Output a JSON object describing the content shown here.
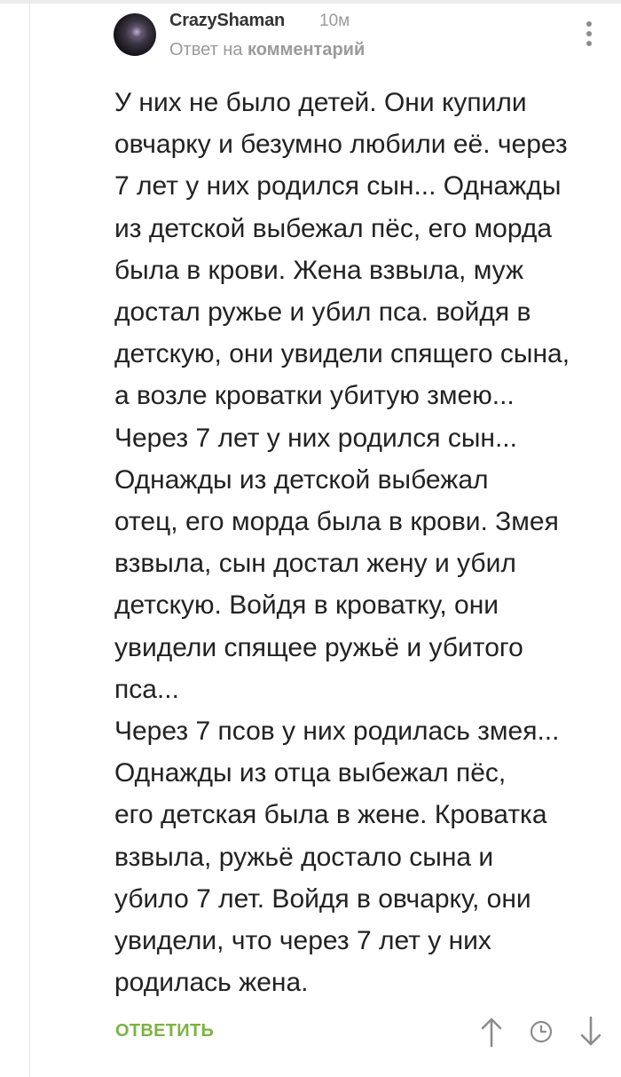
{
  "comment": {
    "author": "CrazyShaman",
    "time": "10м",
    "reply_to_prefix": "Ответ на",
    "reply_to_link": "комментарий",
    "body_lines": [
      "У них не было детей. Они купили",
      "овчарку и безумно любили её. через",
      "7 лет у них родился сын... Однажды",
      "из детской выбежал пёс, его морда",
      "была в крови. Жена взвыла, муж",
      "достал ружье и убил пса. войдя в",
      "детскую, они увидели спящего сына,",
      "а возле кроватки убитую змею...",
      "Через 7 лет у них родился сын...",
      "Однажды из детской выбежал",
      "отец, его морда была в крови. Змея",
      "взвыла, сын достал жену и убил",
      "детскую. Войдя в кроватку, они",
      "увидели спящее ружьё и убитого",
      "пса...",
      "Через 7 псов у них родилась змея...",
      "Однажды из отца выбежал пёс,",
      "его детская была в жене. Кроватка",
      "взвыла, ружьё достало сына и",
      "убило 7 лет. Войдя в овчарку, они",
      "увидели, что через 7 лет у них",
      "родилась жена."
    ],
    "reply_button_label": "ОТВЕТИТЬ"
  },
  "icons": {
    "menu": "more-vertical-icon",
    "vote_up": "arrow-up-icon",
    "clock": "clock-icon",
    "vote_down": "arrow-down-icon"
  },
  "colors": {
    "reply_button": "#7cb342",
    "muted_text": "#9a9a9a",
    "body_text": "#222222",
    "icon_gray": "#8c8c8c"
  }
}
